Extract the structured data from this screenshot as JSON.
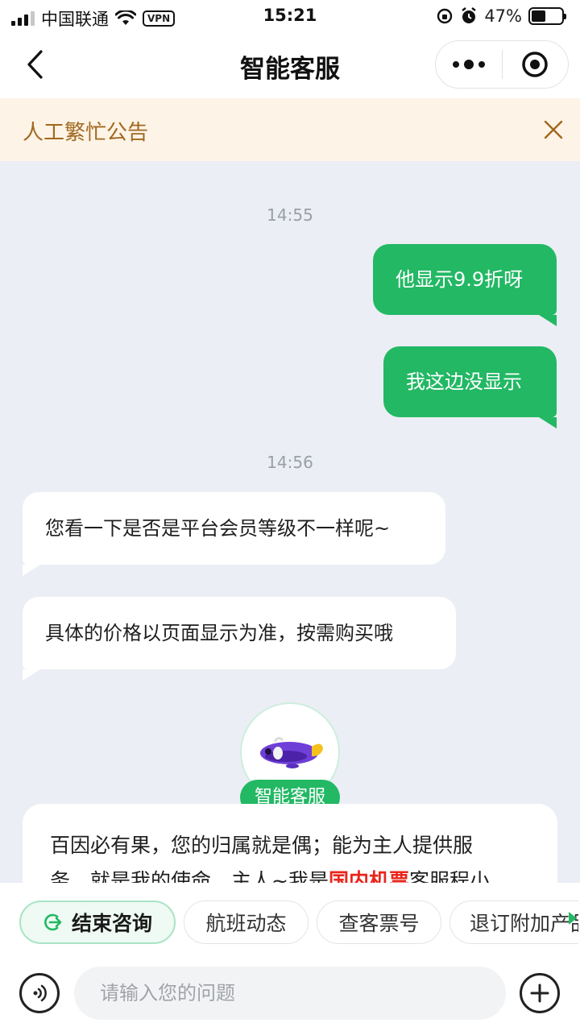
{
  "status_bar": {
    "carrier": "中国联通",
    "vpn": "VPN",
    "time": "15:21",
    "battery": "47%",
    "battery_level": 0.47
  },
  "header": {
    "title": "智能客服"
  },
  "notice": {
    "text": "人工繁忙公告"
  },
  "chat": {
    "messages": [
      {
        "type": "time",
        "text": "14:55"
      },
      {
        "type": "out",
        "text": "他显示9.9折呀"
      },
      {
        "type": "out",
        "text": "我这边没显示"
      },
      {
        "type": "time",
        "text": "14:56"
      },
      {
        "type": "in",
        "text": "您看一下是否是平台会员等级不一样呢~"
      },
      {
        "type": "in",
        "text": "具体的价格以页面显示为准，按需购买哦"
      }
    ],
    "bot": {
      "label": "智能客服",
      "intro_line1": "百因必有果，您的归属就是偶；能为主人提供服",
      "intro_line2_a": "务，就是我的使命。主人~我是",
      "intro_highlight": "国内机票",
      "intro_line2_b": "客服程小"
    }
  },
  "quick_actions": [
    {
      "label": "结束咨询"
    },
    {
      "label": "航班动态"
    },
    {
      "label": "查客票号"
    },
    {
      "label": "退订附加产品"
    }
  ],
  "input_bar": {
    "placeholder": "请输入您的问题"
  },
  "colors": {
    "accent": "#23b864",
    "notice_bg": "#fdf3e6",
    "notice_text": "#a1681e",
    "highlight": "#e8261c",
    "chat_bg": "#ebeef4"
  },
  "icons": {
    "back": "chevron-left-icon",
    "more": "more-dots-icon",
    "target": "target-icon",
    "close": "close-icon",
    "exit": "exit-icon",
    "voice": "voice-icon",
    "plus": "plus-icon"
  }
}
